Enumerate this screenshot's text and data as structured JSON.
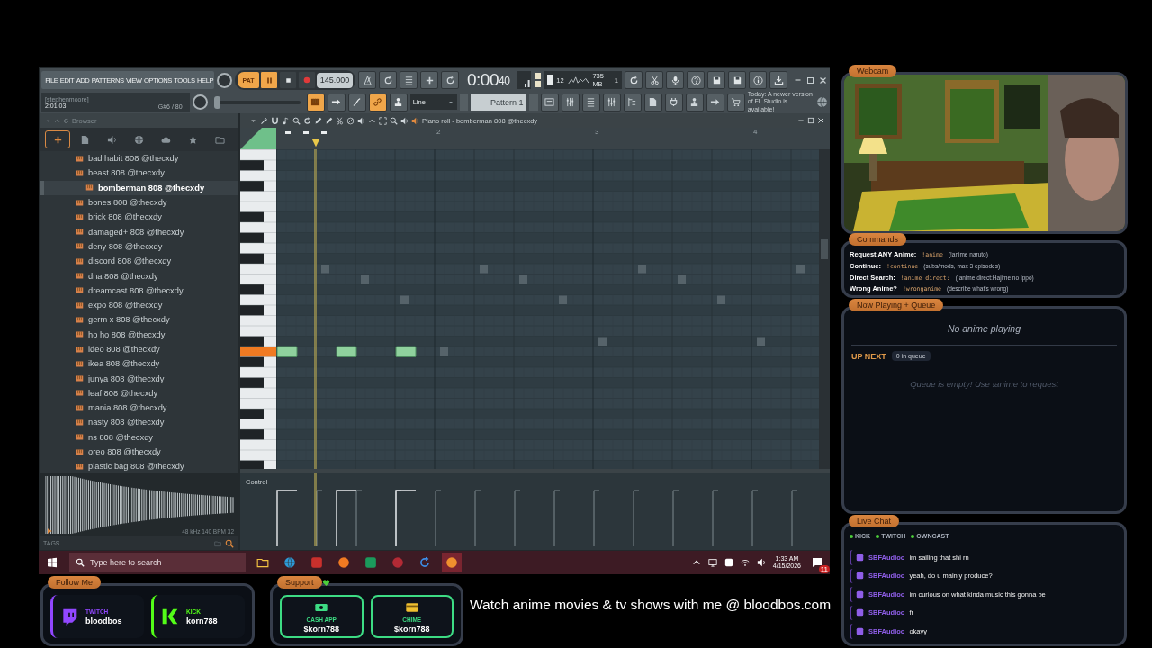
{
  "fl_studio": {
    "menu": [
      "FILE",
      "EDIT",
      "ADD",
      "PATTERNS",
      "VIEW",
      "OPTIONS",
      "TOOLS",
      "HELP"
    ],
    "hint_bar": {
      "user": "[stephenmoore]",
      "time": "2:01:03",
      "note": "G#6 / 80"
    },
    "transport": {
      "mode": "PAT",
      "tempo": "145.000",
      "clock": "0:00",
      "clock_seconds": "40",
      "cpu": "12",
      "memory": "735 MB",
      "polyphony": "1"
    },
    "master_slider": {
      "level": 0.0
    },
    "snap": "Line",
    "pattern": "Pattern 1",
    "news": "Today: A newer version of FL Studio is available!",
    "browser": {
      "title": "Browser",
      "items": [
        {
          "label": "bad habit 808 @thecxdy",
          "selected": false
        },
        {
          "label": "beast 808 @thecxdy",
          "selected": false
        },
        {
          "label": "bomberman 808 @thecxdy",
          "selected": true
        },
        {
          "label": "bones 808 @thecxdy",
          "selected": false
        },
        {
          "label": "brick 808 @thecxdy",
          "selected": false
        },
        {
          "label": "damaged+ 808 @thecxdy",
          "selected": false
        },
        {
          "label": "deny 808 @thecxdy",
          "selected": false
        },
        {
          "label": "discord 808 @thecxdy",
          "selected": false
        },
        {
          "label": "dna 808 @thecxdy",
          "selected": false
        },
        {
          "label": "dreamcast 808 @thecxdy",
          "selected": false
        },
        {
          "label": "expo 808 @thecxdy",
          "selected": false
        },
        {
          "label": "germ x 808 @thecxdy",
          "selected": false
        },
        {
          "label": "ho ho 808 @thecxdy",
          "selected": false
        },
        {
          "label": "ideo 808 @thecxdy",
          "selected": false
        },
        {
          "label": "ikea 808 @thecxdy",
          "selected": false
        },
        {
          "label": "junya 808 @thecxdy",
          "selected": false
        },
        {
          "label": "leaf 808 @thecxdy",
          "selected": false
        },
        {
          "label": "mania 808 @thecxdy",
          "selected": false
        },
        {
          "label": "nasty 808 @thecxdy",
          "selected": false
        },
        {
          "label": "ns 808 @thecxdy",
          "selected": false
        },
        {
          "label": "oreo 808 @thecxdy",
          "selected": false
        },
        {
          "label": "plastic bag 808 @thecxdy",
          "selected": false
        }
      ],
      "sample_info": "48 kHz 140 BPM 32",
      "tags_label": "TAGS"
    },
    "piano_roll": {
      "title": "Piano roll - bomberman 808 @thecxdy",
      "bars": [
        "2",
        "3",
        "4"
      ],
      "control_label": "Control"
    }
  },
  "taskbar": {
    "search_placeholder": "Type here to search",
    "time": "1:33 AM",
    "date": "4/15/2026",
    "notifications": "11"
  },
  "overlay": {
    "webcam": {
      "tag": "Webcam"
    },
    "commands": {
      "tag": "Commands",
      "rows": [
        {
          "label": "Request ANY Anime:",
          "command": "!anime",
          "hint": "(!anime naruto)"
        },
        {
          "label": "Continue:",
          "command": "!continue",
          "hint": "(subs/mods, max 3 episodes)"
        },
        {
          "label": "Direct Search:",
          "command": "!anime direct:",
          "hint": "(!anime direct:Hajime no Ippo)"
        },
        {
          "label": "Wrong Anime?",
          "command": "!wronganime",
          "hint": "(describe what's wrong)"
        }
      ]
    },
    "queue": {
      "tag": "Now Playing + Queue",
      "now_playing": "No anime playing",
      "up_next": "UP NEXT",
      "count": "0 in queue",
      "empty": "Queue is empty! Use !anime to request"
    },
    "chat": {
      "tag": "Live Chat",
      "platforms": [
        "KICK",
        "TWITCH",
        "OWNCAST"
      ],
      "messages": [
        {
          "user": "SBFAudioo",
          "text": "im sailing that shi rn"
        },
        {
          "user": "SBFAudioo",
          "text": "yeah, do u mainly produce?"
        },
        {
          "user": "SBFAudioo",
          "text": "im curious on what kinda music this gonna be"
        },
        {
          "user": "SBFAudioo",
          "text": "fr"
        },
        {
          "user": "SBFAudioo",
          "text": "okayy"
        }
      ]
    },
    "follow": {
      "tag": "Follow Me",
      "accounts": [
        {
          "kind": "twitch",
          "platform": "TWITCH",
          "handle": "bloodbos"
        },
        {
          "kind": "kick",
          "platform": "KICK",
          "handle": "korn788"
        }
      ]
    },
    "support": {
      "tag": "Support",
      "options": [
        {
          "kind": "cashapp",
          "name": "CASH APP",
          "handle": "$korn788"
        },
        {
          "kind": "chime",
          "name": "CHIME",
          "handle": "$korn788"
        }
      ]
    },
    "banner": "Watch anime movies & tv shows with me @ bloodbos.com"
  }
}
